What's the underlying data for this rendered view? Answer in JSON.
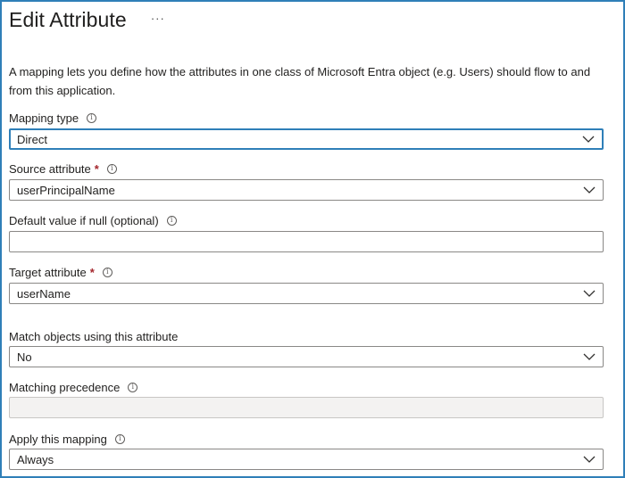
{
  "panel": {
    "title": "Edit Attribute",
    "more_label": "···",
    "description": "A mapping lets you define how the attributes in one class of Microsoft Entra object (e.g. Users) should flow to and from this application."
  },
  "fields": {
    "mapping_type": {
      "label": "Mapping type",
      "value": "Direct"
    },
    "source_attribute": {
      "label": "Source attribute",
      "required_mark": "*",
      "value": "userPrincipalName"
    },
    "default_value": {
      "label": "Default value if null (optional)",
      "value": ""
    },
    "target_attribute": {
      "label": "Target attribute",
      "required_mark": "*",
      "value": "userName"
    },
    "match_objects": {
      "label": "Match objects using this attribute",
      "value": "No"
    },
    "matching_precedence": {
      "label": "Matching precedence",
      "value": ""
    },
    "apply_mapping": {
      "label": "Apply this mapping",
      "value": "Always"
    }
  },
  "icons": {
    "info": "info-icon",
    "dropdown": "chevron-down-icon",
    "more": "more-icon"
  },
  "colors": {
    "accent": "#2f7fb8",
    "required": "#a4262c",
    "border": "#8a8886",
    "disabled_bg": "#f3f2f1"
  }
}
